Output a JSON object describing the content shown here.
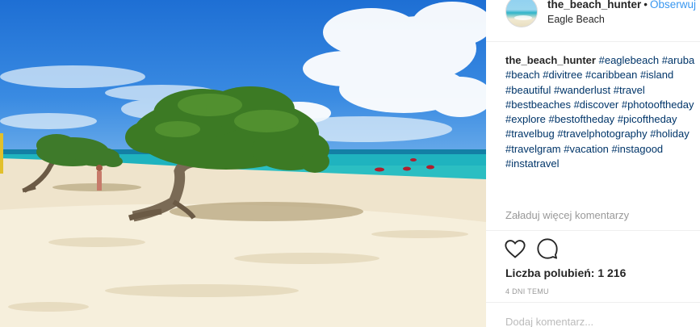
{
  "post": {
    "photo_alt": "",
    "header": {
      "username": "the_beach_hunter",
      "separator": "•",
      "follow_label": "Obserwuj",
      "location": "Eagle Beach"
    },
    "caption": {
      "username": "the_beach_hunter",
      "hashtags": [
        "#eaglebeach",
        "#aruba",
        "#beach",
        "#divitree",
        "#caribbean",
        "#island",
        "#beautiful",
        "#wanderlust",
        "#travel",
        "#bestbeaches",
        "#discover",
        "#photooftheday",
        "#explore",
        "#bestoftheday",
        "#picoftheday",
        "#travelbug",
        "#travelphotography",
        "#holiday",
        "#travelgram",
        "#vacation",
        "#instagood",
        "#instatravel"
      ]
    },
    "load_more_label": "Załaduj więcej komentarzy",
    "actions": {
      "like_icon": "heart-icon",
      "comment_icon": "comment-bubble-icon"
    },
    "likes_text": "Liczba polubień: 1 216",
    "time_text": "4 DNI TEMU",
    "comment_placeholder": "Dodaj komentarz..."
  },
  "colors": {
    "link": "#003569",
    "follow": "#3897f0",
    "muted": "#999999",
    "border": "#efefef"
  }
}
